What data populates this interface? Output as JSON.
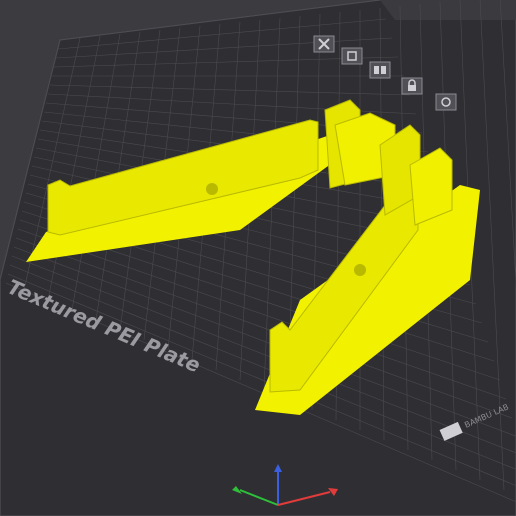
{
  "plate": {
    "label": "Textured PEI Plate",
    "label_visible_prefix": "1",
    "brand": "BAMBU LAB",
    "colors": {
      "background": "#3b3b40",
      "plate": "#2f2f33",
      "grid": "#4a4a50",
      "part": "#f2f200",
      "part_shadow": "#b9b900",
      "edge": "#7a7a80"
    }
  },
  "plate_toolbar": [
    {
      "name": "close-icon",
      "tooltip": ""
    },
    {
      "name": "lock-file-icon",
      "tooltip": ""
    },
    {
      "name": "arrange-icon",
      "tooltip": ""
    },
    {
      "name": "lock-icon",
      "tooltip": ""
    },
    {
      "name": "settings-icon",
      "tooltip": ""
    }
  ],
  "axes": {
    "x_color": "#e23b3b",
    "y_color": "#2fbf3a",
    "z_color": "#3a5fe0"
  }
}
